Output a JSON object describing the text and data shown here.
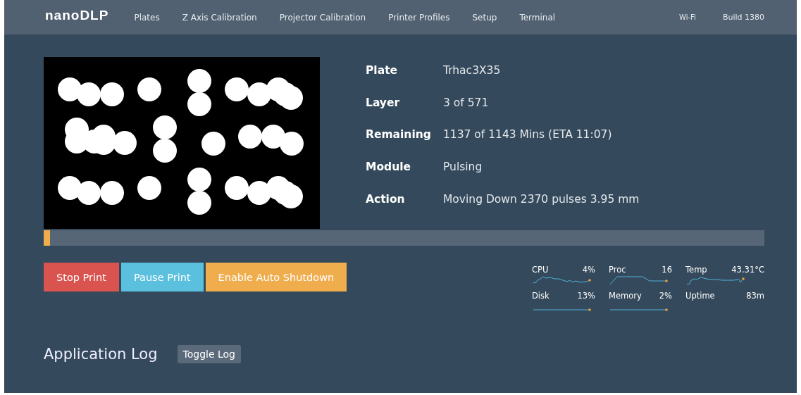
{
  "navbar": {
    "brand": "nanoDLP",
    "links": [
      "Plates",
      "Z Axis Calibration",
      "Projector Calibration",
      "Printer Profiles",
      "Setup",
      "Terminal"
    ],
    "right": [
      "Wi-Fi",
      "Build 1380"
    ]
  },
  "preview": {
    "kind": "layer"
  },
  "info": [
    {
      "label": "Plate",
      "value": "Trhac3X35"
    },
    {
      "label": "Layer",
      "value": "3 of 571"
    },
    {
      "label": "Remaining",
      "value": "1137 of 1143 Mins (ETA 11:07)"
    },
    {
      "label": "Module",
      "value": "Pulsing"
    },
    {
      "label": "Action",
      "value": "Moving Down 2370 pulses 3.95 mm"
    }
  ],
  "progress": {
    "level": 0.009
  },
  "buttons": [
    {
      "label": "Stop Print",
      "kind": "danger"
    },
    {
      "label": "Pause Print",
      "kind": "info"
    },
    {
      "label": "Enable Auto Shutdown",
      "kind": "warning"
    }
  ],
  "stats": [
    {
      "label": "CPU",
      "value": "4%",
      "kind": "graph"
    },
    {
      "label": "Proc",
      "value": "16",
      "kind": "graph"
    },
    {
      "label": "Temp",
      "value": "43.31°C",
      "kind": "graph"
    },
    {
      "label": "Disk",
      "value": "13%",
      "kind": "graph"
    },
    {
      "label": "Memory",
      "value": "2%",
      "kind": "graph"
    },
    {
      "label": "Uptime",
      "value": "83m",
      "kind": "plain"
    }
  ],
  "log": {
    "title": "Application Log",
    "toggle": "Toggle Log"
  }
}
